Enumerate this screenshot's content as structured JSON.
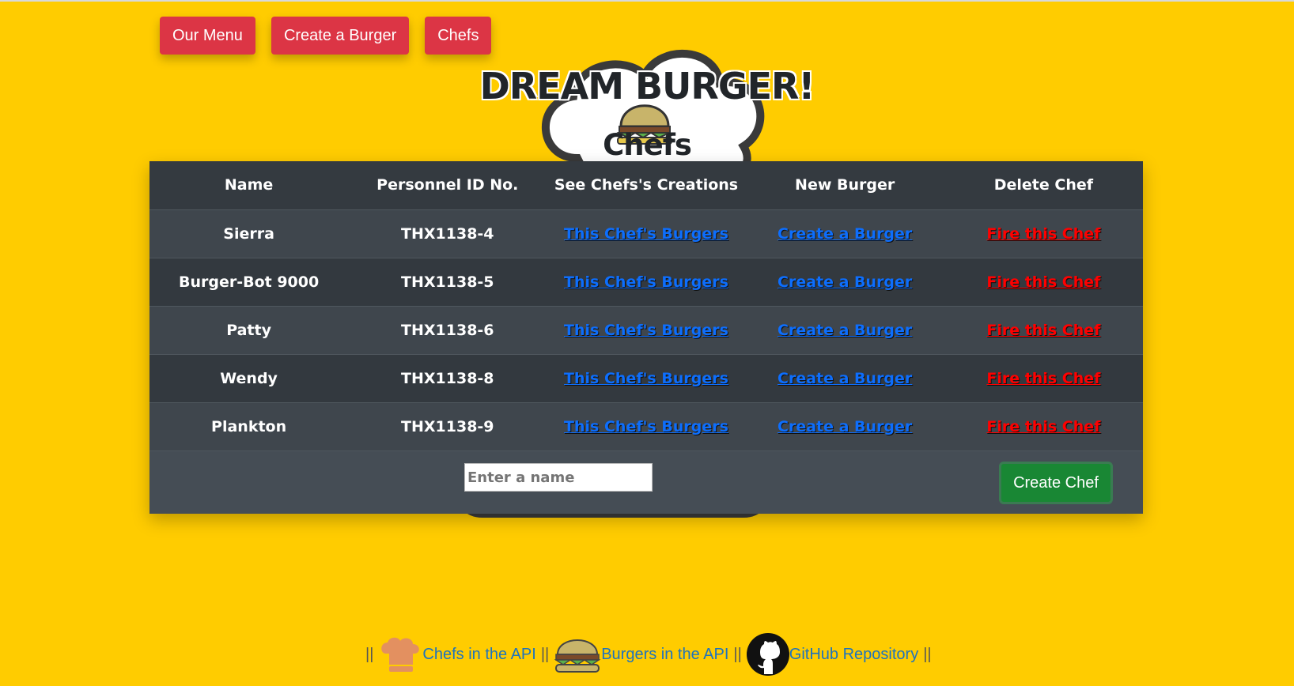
{
  "nav": [
    {
      "label": "Our Menu"
    },
    {
      "label": "Create a Burger"
    },
    {
      "label": "Chefs"
    }
  ],
  "title": "DREAM BURGER!",
  "subtitle": "Chefs",
  "table": {
    "headers": [
      "Name",
      "Personnel ID No.",
      "See Chefs's Creations",
      "New Burger",
      "Delete Chef"
    ],
    "rows": [
      {
        "name": "Sierra",
        "id": "THX1138-4",
        "creations": "This Chef's Burgers",
        "new": "Create a Burger",
        "delete": "Fire this Chef"
      },
      {
        "name": "Burger-Bot 9000",
        "id": "THX1138-5",
        "creations": "This Chef's Burgers",
        "new": "Create a Burger",
        "delete": "Fire this Chef"
      },
      {
        "name": "Patty",
        "id": "THX1138-6",
        "creations": "This Chef's Burgers",
        "new": "Create a Burger",
        "delete": "Fire this Chef"
      },
      {
        "name": "Wendy",
        "id": "THX1138-8",
        "creations": "This Chef's Burgers",
        "new": "Create a Burger",
        "delete": "Fire this Chef"
      },
      {
        "name": "Plankton",
        "id": "THX1138-9",
        "creations": "This Chef's Burgers",
        "new": "Create a Burger",
        "delete": "Fire this Chef"
      }
    ]
  },
  "form": {
    "placeholder": "Enter a name",
    "value": "",
    "submit_label": "Create Chef"
  },
  "footer": {
    "separator": "||",
    "links": [
      {
        "label": "Chefs in the API",
        "icon": "chef-hat-icon"
      },
      {
        "label": "Burgers in the API",
        "icon": "burger-icon"
      },
      {
        "label": "GitHub Repository",
        "icon": "github-icon"
      }
    ]
  },
  "colors": {
    "background": "#ffcc00",
    "nav_button": "#dc3545",
    "table_header": "#343a40",
    "link_blue": "#0d6efd",
    "fire_red": "#ff0000",
    "create_button": "#198734"
  }
}
